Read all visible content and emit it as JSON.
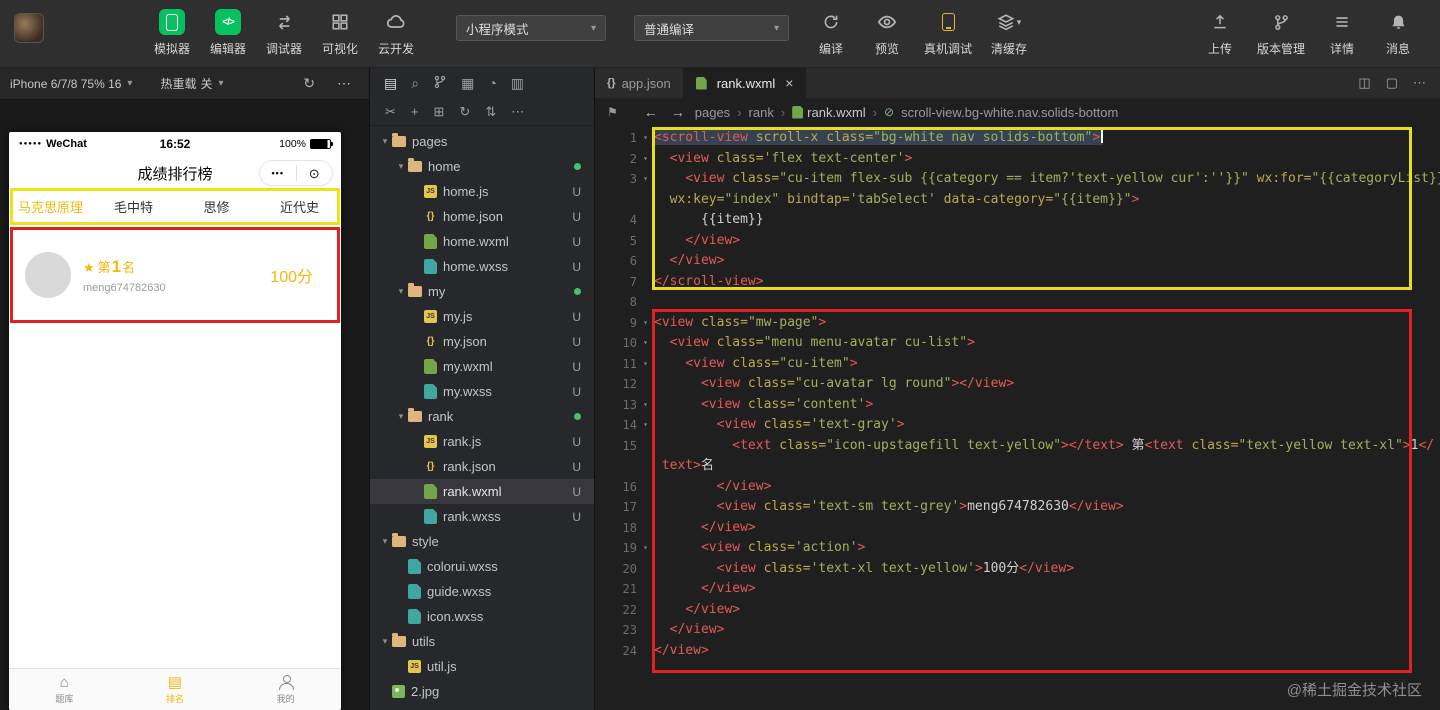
{
  "icons": {
    "chevron_down": "▾",
    "more_h": "⋯",
    "close": "×",
    "separator": "›",
    "back_arrow": "←",
    "forward_arrow": "→",
    "bookmark": "⚑",
    "selector": "⊘",
    "home": "⌂",
    "rank_list": "▤",
    "medal": "★",
    "signal_dots": "●●●●●",
    "capsule_dots": "•••",
    "capsule_target": "⊙",
    "files": "▤",
    "search": "⌕",
    "grid_blocks": "▦",
    "disc": "◔",
    "panel": "▥",
    "cut": "✂",
    "plus": "+",
    "new_folder": "⊞",
    "refresh": "↻",
    "sort": "⇅",
    "split": "◫",
    "box": "▢",
    "braces": "{}"
  },
  "topbar": {
    "tools": [
      {
        "label": "模拟器"
      },
      {
        "label": "编辑器"
      },
      {
        "label": "调试器"
      },
      {
        "label": "可视化"
      },
      {
        "label": "云开发"
      }
    ],
    "mode_select": {
      "value": "小程序模式"
    },
    "compile_select": {
      "value": "普通编译"
    },
    "actions": [
      {
        "label": "编译"
      },
      {
        "label": "预览"
      },
      {
        "label": "真机调试"
      },
      {
        "label": "清缓存"
      }
    ],
    "right_actions": [
      {
        "label": "上传"
      },
      {
        "label": "版本管理"
      },
      {
        "label": "详情"
      },
      {
        "label": "消息"
      }
    ]
  },
  "simulator": {
    "device_label": "iPhone 6/7/8 75% 16",
    "hot_reload": {
      "label": "热重载",
      "state": "关"
    },
    "phone": {
      "carrier": "WeChat",
      "time": "16:52",
      "battery": "100%",
      "nav_title": "成绩排行榜",
      "category_tabs": [
        {
          "label": "马克思原理",
          "active": true
        },
        {
          "label": "毛中特"
        },
        {
          "label": "思修"
        },
        {
          "label": "近代史"
        }
      ],
      "rank_item": {
        "prefix": "第",
        "rank_num": "1",
        "suffix": "名",
        "username": "meng674782630",
        "score": "100分"
      },
      "tabbar": [
        {
          "label": "题库"
        },
        {
          "label": "排名",
          "active": true
        },
        {
          "label": "我的"
        }
      ]
    }
  },
  "explorer": {
    "tree": [
      {
        "depth": 0,
        "type": "folder",
        "label": "pages"
      },
      {
        "depth": 1,
        "type": "folder",
        "label": "home",
        "dot": true
      },
      {
        "depth": 2,
        "type": "js",
        "label": "home.js",
        "badge": "U"
      },
      {
        "depth": 2,
        "type": "json",
        "label": "home.json",
        "badge": "U"
      },
      {
        "depth": 2,
        "type": "wxml",
        "label": "home.wxml",
        "badge": "U"
      },
      {
        "depth": 2,
        "type": "wxss",
        "label": "home.wxss",
        "badge": "U"
      },
      {
        "depth": 1,
        "type": "folder",
        "label": "my",
        "dot": true
      },
      {
        "depth": 2,
        "type": "js",
        "label": "my.js",
        "badge": "U"
      },
      {
        "depth": 2,
        "type": "json",
        "label": "my.json",
        "badge": "U"
      },
      {
        "depth": 2,
        "type": "wxml",
        "label": "my.wxml",
        "badge": "U"
      },
      {
        "depth": 2,
        "type": "wxss",
        "label": "my.wxss",
        "badge": "U"
      },
      {
        "depth": 1,
        "type": "folder",
        "label": "rank",
        "dot": true
      },
      {
        "depth": 2,
        "type": "js",
        "label": "rank.js",
        "badge": "U"
      },
      {
        "depth": 2,
        "type": "json",
        "label": "rank.json",
        "badge": "U"
      },
      {
        "depth": 2,
        "type": "wxml",
        "label": "rank.wxml",
        "badge": "U",
        "selected": true
      },
      {
        "depth": 2,
        "type": "wxss",
        "label": "rank.wxss",
        "badge": "U"
      },
      {
        "depth": 0,
        "type": "folder",
        "label": "style"
      },
      {
        "depth": 1,
        "type": "wxss",
        "label": "colorui.wxss"
      },
      {
        "depth": 1,
        "type": "wxss",
        "label": "guide.wxss"
      },
      {
        "depth": 1,
        "type": "wxss",
        "label": "icon.wxss"
      },
      {
        "depth": 0,
        "type": "folder",
        "label": "utils"
      },
      {
        "depth": 1,
        "type": "js",
        "label": "util.js"
      },
      {
        "depth": 0,
        "type": "img",
        "label": "2.jpg"
      }
    ]
  },
  "editor": {
    "tabs": [
      {
        "label": "app.json",
        "active": false
      },
      {
        "label": "rank.wxml",
        "active": true
      }
    ],
    "breadcrumb": {
      "path": [
        "pages",
        "rank"
      ],
      "file": "rank.wxml",
      "selector": "scroll-view.bg-white.nav.solids-bottom"
    },
    "code_rows": [
      {
        "n": "1",
        "fold": true,
        "sel": true,
        "caret": true,
        "tokens": [
          [
            "t",
            "<scroll-view"
          ],
          [
            "a",
            " scroll-x class="
          ],
          [
            "s",
            "\"bg-white nav solids-bottom\""
          ],
          [
            "t",
            ">"
          ]
        ]
      },
      {
        "n": "2",
        "fold": true,
        "tokens": [
          [
            "x",
            "  "
          ],
          [
            "t",
            "<view"
          ],
          [
            "a",
            " class="
          ],
          [
            "s",
            "'flex text-center'"
          ],
          [
            "t",
            ">"
          ]
        ]
      },
      {
        "n": "3",
        "fold": true,
        "tokens": [
          [
            "x",
            "    "
          ],
          [
            "t",
            "<view"
          ],
          [
            "a",
            " class="
          ],
          [
            "s",
            "\"cu-item flex-sub {{category == item?'text-yellow cur':''}}\""
          ],
          [
            "a",
            " wx:for="
          ],
          [
            "s",
            "\"{{categoryList}}\""
          ]
        ]
      },
      {
        "tokens": [
          [
            "x",
            "  "
          ],
          [
            "a",
            "wx:key="
          ],
          [
            "s",
            "\"index\""
          ],
          [
            "a",
            " bindtap="
          ],
          [
            "s",
            "'tabSelect'"
          ],
          [
            "a",
            " data-category="
          ],
          [
            "s",
            "\"{{item}}\""
          ],
          [
            "t",
            ">"
          ]
        ]
      },
      {
        "n": "4",
        "tokens": [
          [
            "x",
            "      {{item}}"
          ]
        ]
      },
      {
        "n": "5",
        "tokens": [
          [
            "x",
            "    "
          ],
          [
            "t",
            "</view>"
          ]
        ]
      },
      {
        "n": "6",
        "tokens": [
          [
            "x",
            "  "
          ],
          [
            "t",
            "</view>"
          ]
        ]
      },
      {
        "n": "7",
        "tokens": [
          [
            "t",
            "</scroll-view>"
          ]
        ]
      },
      {
        "n": "8",
        "tokens": []
      },
      {
        "n": "9",
        "fold": true,
        "tokens": [
          [
            "t",
            "<view"
          ],
          [
            "a",
            " class="
          ],
          [
            "s",
            "\"mw-page\""
          ],
          [
            "t",
            ">"
          ]
        ]
      },
      {
        "n": "10",
        "fold": true,
        "tokens": [
          [
            "x",
            "  "
          ],
          [
            "t",
            "<view"
          ],
          [
            "a",
            " class="
          ],
          [
            "s",
            "\"menu menu-avatar cu-list\""
          ],
          [
            "t",
            ">"
          ]
        ]
      },
      {
        "n": "11",
        "fold": true,
        "tokens": [
          [
            "x",
            "    "
          ],
          [
            "t",
            "<view"
          ],
          [
            "a",
            " class="
          ],
          [
            "s",
            "\"cu-item\""
          ],
          [
            "t",
            ">"
          ]
        ]
      },
      {
        "n": "12",
        "tokens": [
          [
            "x",
            "      "
          ],
          [
            "t",
            "<view"
          ],
          [
            "a",
            " class="
          ],
          [
            "s",
            "\"cu-avatar lg round\""
          ],
          [
            "t",
            "></view>"
          ]
        ]
      },
      {
        "n": "13",
        "fold": true,
        "tokens": [
          [
            "x",
            "      "
          ],
          [
            "t",
            "<view"
          ],
          [
            "a",
            " class="
          ],
          [
            "s",
            "'content'"
          ],
          [
            "t",
            ">"
          ]
        ]
      },
      {
        "n": "14",
        "fold": true,
        "tokens": [
          [
            "x",
            "        "
          ],
          [
            "t",
            "<view"
          ],
          [
            "a",
            " class="
          ],
          [
            "s",
            "'text-gray'"
          ],
          [
            "t",
            ">"
          ]
        ]
      },
      {
        "n": "15",
        "tokens": [
          [
            "x",
            "          "
          ],
          [
            "t",
            "<text"
          ],
          [
            "a",
            " class="
          ],
          [
            "s",
            "\"icon-upstagefill text-yellow\""
          ],
          [
            "t",
            "></text>"
          ],
          [
            "x",
            " 第"
          ],
          [
            "t",
            "<text"
          ],
          [
            "a",
            " class="
          ],
          [
            "s",
            "\"text-yellow text-xl\""
          ],
          [
            "t",
            ">"
          ],
          [
            "x",
            "1"
          ],
          [
            "t",
            "</"
          ]
        ]
      },
      {
        "tokens": [
          [
            "x",
            " "
          ],
          [
            "t",
            "text>"
          ],
          [
            "x",
            "名"
          ]
        ]
      },
      {
        "n": "16",
        "tokens": [
          [
            "x",
            "        "
          ],
          [
            "t",
            "</view>"
          ]
        ]
      },
      {
        "n": "17",
        "tokens": [
          [
            "x",
            "        "
          ],
          [
            "t",
            "<view"
          ],
          [
            "a",
            " class="
          ],
          [
            "s",
            "'text-sm text-grey'"
          ],
          [
            "t",
            ">"
          ],
          [
            "x",
            "meng674782630"
          ],
          [
            "t",
            "</view>"
          ]
        ]
      },
      {
        "n": "18",
        "tokens": [
          [
            "x",
            "      "
          ],
          [
            "t",
            "</view>"
          ]
        ]
      },
      {
        "n": "19",
        "fold": true,
        "tokens": [
          [
            "x",
            "      "
          ],
          [
            "t",
            "<view"
          ],
          [
            "a",
            " class="
          ],
          [
            "s",
            "'action'"
          ],
          [
            "t",
            ">"
          ]
        ]
      },
      {
        "n": "20",
        "tokens": [
          [
            "x",
            "        "
          ],
          [
            "t",
            "<view"
          ],
          [
            "a",
            " class="
          ],
          [
            "s",
            "'text-xl text-yellow'"
          ],
          [
            "t",
            ">"
          ],
          [
            "x",
            "100分"
          ],
          [
            "t",
            "</view>"
          ]
        ]
      },
      {
        "n": "21",
        "tokens": [
          [
            "x",
            "      "
          ],
          [
            "t",
            "</view>"
          ]
        ]
      },
      {
        "n": "22",
        "tokens": [
          [
            "x",
            "    "
          ],
          [
            "t",
            "</view>"
          ]
        ]
      },
      {
        "n": "23",
        "tokens": [
          [
            "x",
            "  "
          ],
          [
            "t",
            "</view>"
          ]
        ]
      },
      {
        "n": "24",
        "tokens": [
          [
            "t",
            "</view>"
          ]
        ]
      }
    ]
  },
  "watermark": "@稀土掘金技术社区"
}
